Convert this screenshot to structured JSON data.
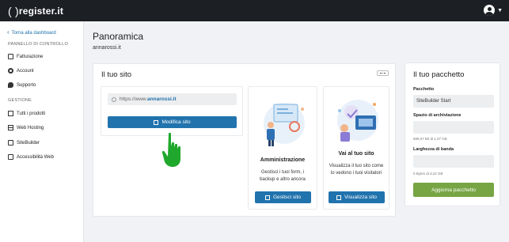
{
  "brand": {
    "logo_paren": "( )",
    "logo_text": "register.it"
  },
  "sidebar": {
    "back_label": "Torna alla dashboard",
    "section_panel": "PANNELLO DI CONTROLLO",
    "items_top": [
      {
        "label": "Fatturazione",
        "icon": "invoice-icon"
      },
      {
        "label": "Account",
        "icon": "gear-icon"
      },
      {
        "label": "Supporto",
        "icon": "chat-icon"
      }
    ],
    "section_manage": "GESTIONE",
    "items_bottom": [
      {
        "label": "Tutti i prodotti",
        "icon": "boxes-icon"
      },
      {
        "label": "Web Hosting",
        "icon": "server-icon"
      },
      {
        "label": "SiteBuilder",
        "icon": "sitebuilder-icon"
      },
      {
        "label": "Accessibilità Web",
        "icon": "accessibility-icon"
      }
    ]
  },
  "main": {
    "title": "Panoramica",
    "domain": "annarossi.it"
  },
  "site_card": {
    "title": "Il tuo sito",
    "url_prefix": "https://www.",
    "url_domain": "annarossi.it",
    "edit_button": "Modifica sito",
    "admin": {
      "title": "Amministrazione",
      "desc": "Gestisci i tuoi form, i backup e altro ancora",
      "button": "Gestisci sito"
    },
    "visit": {
      "title": "Vai al tuo sito",
      "desc": "Visualizza il tuo sito come lo vedono i tuoi visitatori",
      "button": "Visualizza sito"
    }
  },
  "package_card": {
    "title": "Il tuo pacchetto",
    "package_label": "Pacchetto",
    "package_value": "SiteBuilder Start",
    "storage_label": "Spazio di archiviazione",
    "storage_usage": "589,07 kB di 1,07 GB",
    "bandwidth_label": "Larghezza di banda",
    "bandwidth_usage": "0 Bytes di 3,22 GB",
    "upgrade_button": "Aggiorna pacchetto"
  },
  "colors": {
    "topbar": "#1c1f24",
    "primary": "#2173ad",
    "upgrade": "#78a544",
    "hand": "#1fa82c"
  }
}
